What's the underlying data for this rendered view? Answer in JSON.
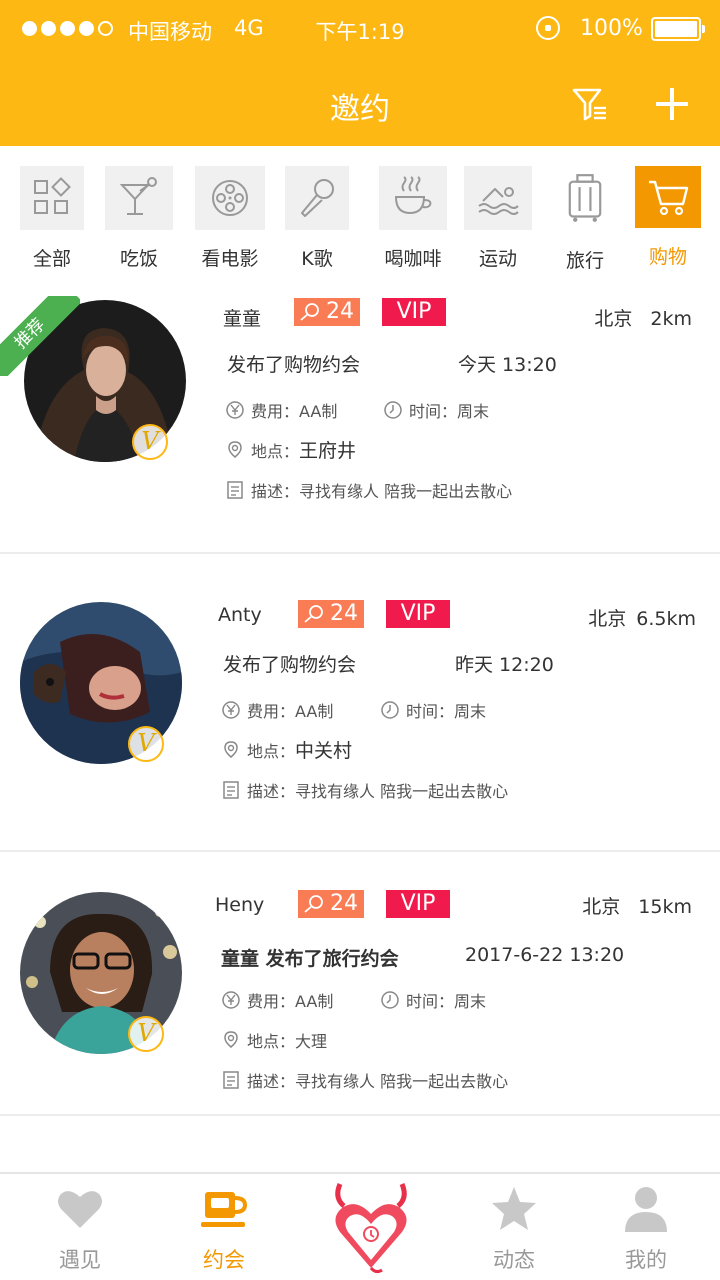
{
  "status_bar": {
    "carrier": "中国移动",
    "network": "4G",
    "time": "下午1:19",
    "battery": "100%"
  },
  "header": {
    "title": "邀约",
    "filter_icon": "filter-icon",
    "add_icon": "plus-icon"
  },
  "categories": [
    {
      "label": "全部",
      "icon": "grid-icon"
    },
    {
      "label": "吃饭",
      "icon": "cocktail-icon"
    },
    {
      "label": "看电影",
      "icon": "film-reel-icon"
    },
    {
      "label": "K歌",
      "icon": "microphone-icon"
    },
    {
      "label": "喝咖啡",
      "icon": "coffee-cup-icon"
    },
    {
      "label": "运动",
      "icon": "swimmer-icon"
    },
    {
      "label": "旅行",
      "icon": "suitcase-icon"
    },
    {
      "label": "购物",
      "icon": "cart-icon",
      "active": true
    }
  ],
  "list": [
    {
      "ribbon": "推荐",
      "name": "童童",
      "points": "24",
      "vip": "VIP",
      "city": "北京",
      "distance": "2km",
      "headline": "发布了购物约会",
      "when": "今天 13:20",
      "fee_label": "费用：",
      "fee": "AA制",
      "time_label": "时间：",
      "time": "周末",
      "place_label": "地点：",
      "place": "王府井",
      "desc_label": "描述：",
      "desc": "寻找有缘人 陪我一起出去散心",
      "badge": "V"
    },
    {
      "name": "Anty",
      "points": "24",
      "vip": "VIP",
      "city": "北京",
      "distance": "6.5km",
      "headline": "发布了购物约会",
      "when": "昨天 12:20",
      "fee_label": "费用：",
      "fee": "AA制",
      "time_label": "时间：",
      "time": "周末",
      "place_label": "地点：",
      "place": "中关村",
      "desc_label": "描述：",
      "desc": "寻找有缘人 陪我一起出去散心",
      "badge": "V"
    },
    {
      "name": "Heny",
      "points": "24",
      "vip": "VIP",
      "city": "北京",
      "distance": "15km",
      "headline": "童童 发布了旅行约会",
      "when": "2017-6-22 13:20",
      "fee_label": "费用：",
      "fee": "AA制",
      "time_label": "时间：",
      "time": "周末",
      "place_label": "地点：",
      "place": "大理",
      "desc_label": "描述：",
      "desc": "寻找有缘人 陪我一起出去散心",
      "badge": "V"
    }
  ],
  "tabbar": {
    "tabs": [
      {
        "label": "遇见",
        "icon": "heart-icon"
      },
      {
        "label": "约会",
        "icon": "coffee-cup-icon",
        "active": true
      },
      {
        "label": "",
        "icon": "devil-heart-logo-icon"
      },
      {
        "label": "动态",
        "icon": "star-icon"
      },
      {
        "label": "我的",
        "icon": "person-icon"
      }
    ]
  },
  "colors": {
    "brand": "#FDB813",
    "accent": "#F39800",
    "vip": "#F01B4C",
    "points": "#F97C55",
    "ribbon": "#4CAF50"
  }
}
